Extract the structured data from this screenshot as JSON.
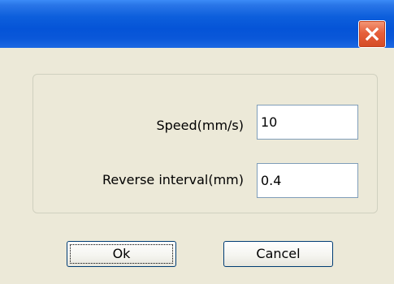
{
  "window": {
    "title": "",
    "close_icon": "close-icon"
  },
  "form": {
    "speed_label": "Speed(mm/s)",
    "speed_value": "10",
    "reverse_label": "Reverse interval(mm)",
    "reverse_value": "0.4"
  },
  "buttons": {
    "ok_label": "Ok",
    "cancel_label": "Cancel"
  },
  "colors": {
    "titlebar": "#0554d7",
    "close_button": "#e6603c",
    "dialog_background": "#ece9d8",
    "input_border": "#7f9db9",
    "button_border": "#003c74"
  }
}
